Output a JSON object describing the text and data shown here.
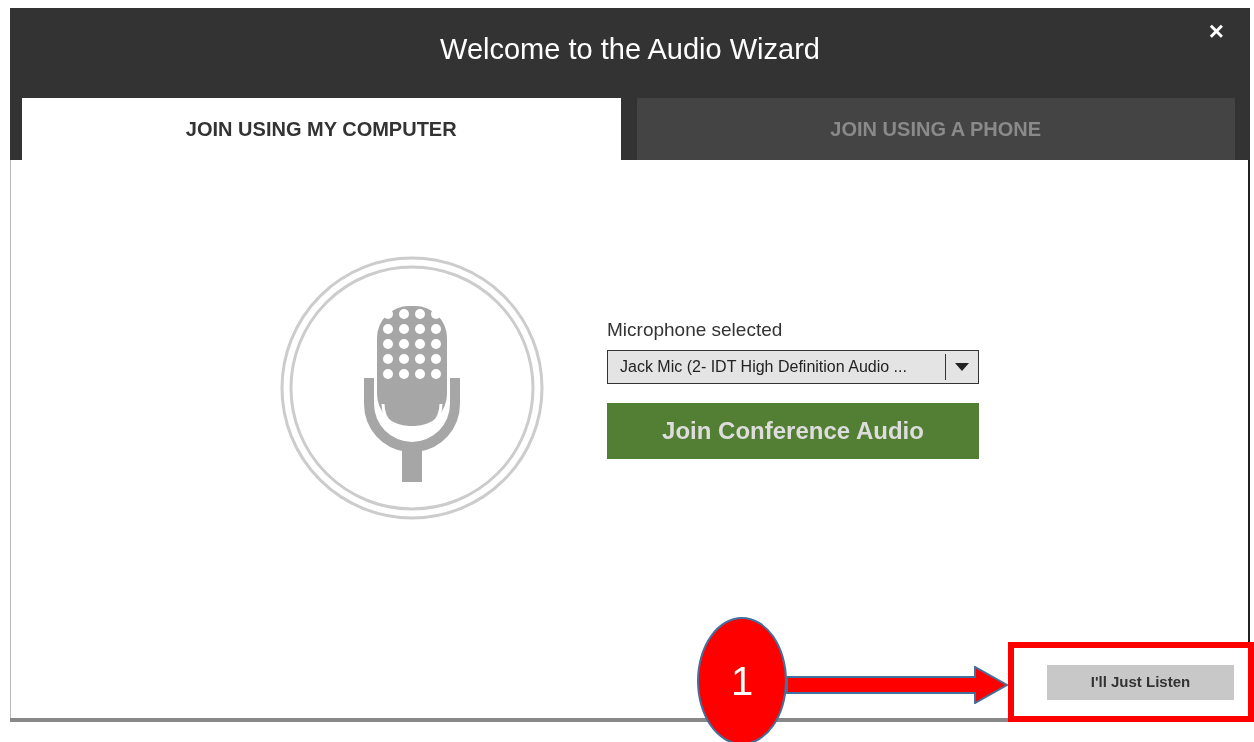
{
  "dialog": {
    "title": "Welcome to the Audio Wizard",
    "close": "×"
  },
  "tabs": [
    {
      "label": "JOIN USING MY COMPUTER",
      "selected": true
    },
    {
      "label": "JOIN USING A PHONE",
      "selected": false
    }
  ],
  "microphone": {
    "label": "Microphone selected",
    "value": "Jack Mic (2- IDT High Definition Audio ..."
  },
  "join_button": "Join Conference Audio",
  "listen_button": "I'll Just Listen",
  "callout": {
    "number": "1"
  }
}
